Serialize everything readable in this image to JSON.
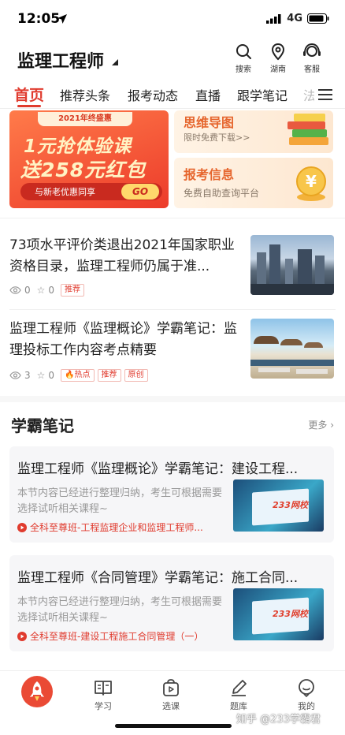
{
  "status": {
    "time": "12:05",
    "network": "4G"
  },
  "header": {
    "title": "监理工程师",
    "search_label": "搜索",
    "location_label": "湖南",
    "service_label": "客服"
  },
  "tabs": [
    {
      "label": "首页"
    },
    {
      "label": "推荐头条"
    },
    {
      "label": "报考动态"
    },
    {
      "label": "直播"
    },
    {
      "label": "跟学笔记"
    },
    {
      "label": "法"
    }
  ],
  "banners": {
    "promo": {
      "top": "2021年终盛惠",
      "line1": "1元抢体验课",
      "line2": "送258元红包",
      "sub": "与新老优惠同享",
      "go": "GO"
    },
    "mindmap": {
      "title": "思维导图",
      "sub": "限时免费下载>>"
    },
    "exam_info": {
      "title": "报考信息",
      "sub": "免费自助查询平台"
    }
  },
  "articles": [
    {
      "title": "73项水平评价类退出2021年国家职业资格目录，监理工程师仍属于准...",
      "views": "0",
      "stars": "0",
      "tags": [
        "推荐"
      ]
    },
    {
      "title": "监理工程师《监理概论》学霸笔记：监理投标工作内容考点精要",
      "views": "3",
      "stars": "0",
      "tags": [
        "热点",
        "推荐",
        "原创"
      ]
    }
  ],
  "notes_section": {
    "title": "学霸笔记",
    "more": "更多"
  },
  "notes": [
    {
      "title": "监理工程师《监理概论》学霸笔记：建设工程...",
      "desc": "本节内容已经进行整理归纳，考生可根据需要选择试听相关课程~",
      "course": "全科至尊班-工程监理企业和监理工程师..."
    },
    {
      "title": "监理工程师《合同管理》学霸笔记：施工合同...",
      "desc": "本节内容已经进行整理归纳，考生可根据需要选择试听相关课程~",
      "course": "全科至尊班-建设工程施工合同管理（一）"
    }
  ],
  "note_thumb_text": "233网校",
  "tabbar": [
    {
      "label": ""
    },
    {
      "label": "学习"
    },
    {
      "label": "选课"
    },
    {
      "label": "题库"
    },
    {
      "label": "我的"
    }
  ],
  "watermark": "知乎 @233学霸君",
  "colors": {
    "accent": "#e03b2e",
    "text": "#222222",
    "muted": "#999999"
  }
}
